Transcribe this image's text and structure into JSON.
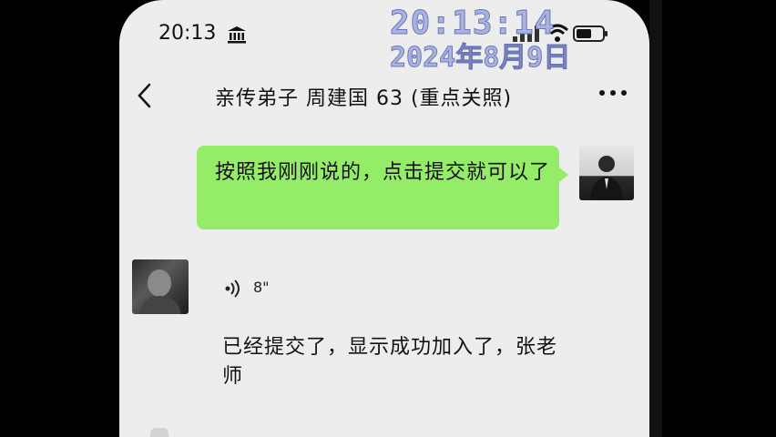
{
  "status_bar": {
    "time": "20:13"
  },
  "watermark": {
    "time": "20:13:14",
    "date": "2024年8月9日"
  },
  "header": {
    "title": "亲传弟子 周建国 63 (重点关照)"
  },
  "messages": [
    {
      "direction": "outgoing",
      "type": "text",
      "text": "按照我刚刚说的，点击提交就可以了"
    },
    {
      "direction": "incoming",
      "type": "voice",
      "duration": "8\""
    },
    {
      "direction": "incoming",
      "type": "text",
      "text": "已经提交了，显示成功加入了，张老师"
    }
  ],
  "icons": [
    "bank-icon",
    "signal-icon",
    "wifi-icon",
    "battery-icon",
    "back-icon",
    "more-icon",
    "voice-icon"
  ],
  "colors": {
    "background": "#ededed",
    "outgoing_bubble": "#95ec69",
    "watermark": "#aab3df"
  }
}
